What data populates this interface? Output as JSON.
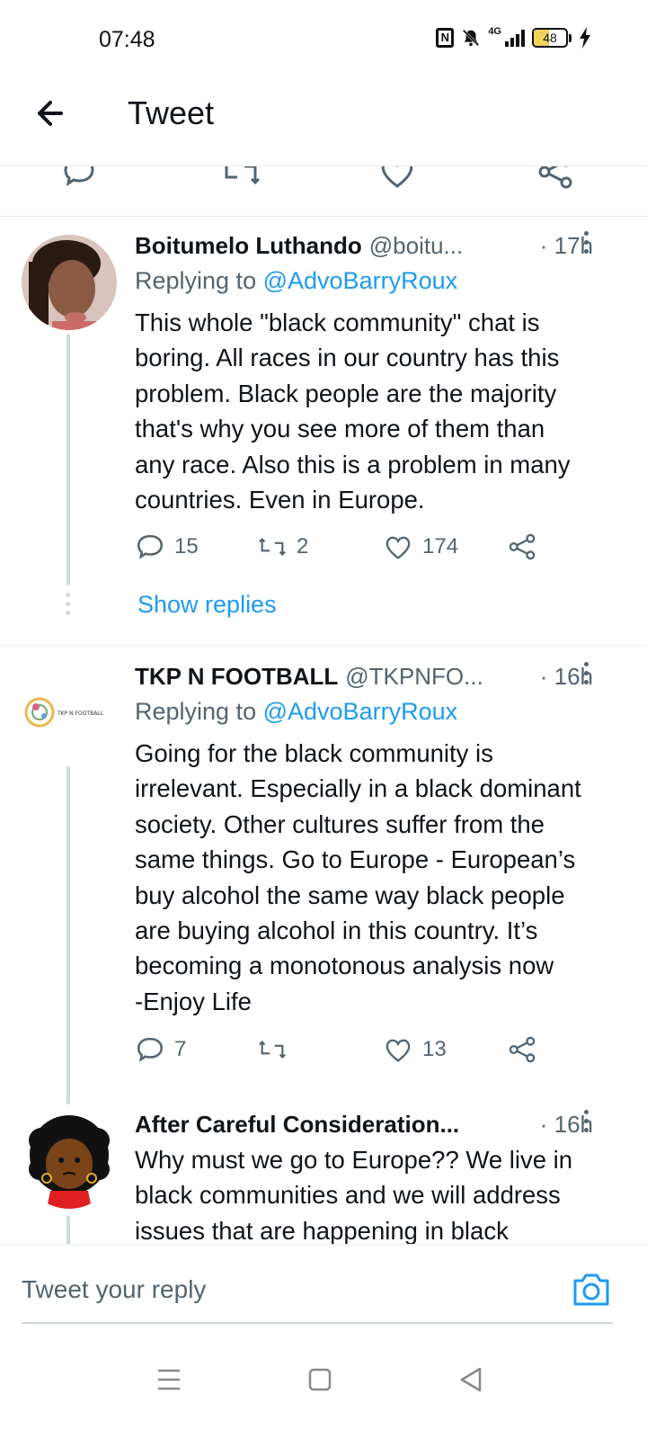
{
  "status_bar": {
    "time": "07:48",
    "network": "4G",
    "battery_level": "48",
    "battery_percent": 48
  },
  "header": {
    "title": "Tweet",
    "back_icon": "arrow-left-icon"
  },
  "tweets": [
    {
      "author_name": "Boitumelo Luthando",
      "handle": "@boitu...",
      "time": "· 17h",
      "replying_label": "Replying to",
      "replying_to": "@AdvoBarryRoux",
      "lines": [
        "This whole \"black community\" chat is",
        "boring. All races in our country has this",
        "problem. Black people are the majority",
        "that's why you see more of them than",
        "any race. Also this is a problem in many",
        "countries. Even in Europe."
      ],
      "replies": "15",
      "retweets": "2",
      "likes": "174",
      "show_replies": "Show replies"
    },
    {
      "author_name": "TKP N FOOTBALL",
      "handle": "@TKPNFO...",
      "time": "· 16h",
      "avatar_text": "TKP N FOOTBALL",
      "replying_label": "Replying to",
      "replying_to": "@AdvoBarryRoux",
      "lines": [
        "Going for the black community is",
        "irrelevant. Especially in a black dominant",
        "society. Other cultures suffer from the",
        "same things. Go to Europe - European’s",
        "buy alcohol the same way black people",
        "are buying alcohol in this country. It’s",
        "becoming a monotonous analysis now",
        "-Enjoy Life"
      ],
      "replies": "7",
      "retweets": "",
      "likes": "13"
    },
    {
      "author_name": "After Careful Consideration...",
      "time": "· 16h",
      "lines": [
        "Why must we go to Europe?? We live in",
        "black communities and we will address",
        "issues that are happening in black"
      ]
    }
  ],
  "composer": {
    "placeholder": "Tweet your reply"
  },
  "colors": {
    "accent": "#1d9bf0",
    "text_primary": "#0f1419",
    "text_secondary": "#536471",
    "divider": "#e6ecf0",
    "thread_line": "#cfd9de"
  }
}
